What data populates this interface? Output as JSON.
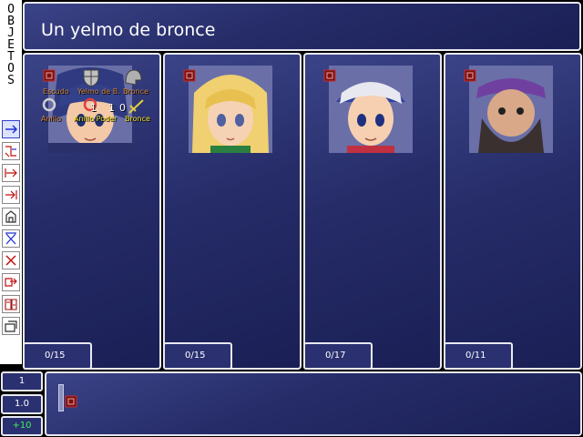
{
  "sidebar": {
    "label_letters": [
      "O",
      "B",
      "J",
      "E",
      "T",
      "O",
      "S"
    ],
    "tools": [
      {
        "name": "arrow-right-tool-icon",
        "active": true
      },
      {
        "name": "swap-tool-icon"
      },
      {
        "name": "move-to-tool-icon"
      },
      {
        "name": "move-to-end-tool-icon"
      },
      {
        "name": "equip-tool-icon"
      },
      {
        "name": "unequip-tool-icon"
      },
      {
        "name": "discard-tool-icon"
      },
      {
        "name": "transfer-tool-icon"
      },
      {
        "name": "sort-tool-icon"
      },
      {
        "name": "window-tool-icon"
      }
    ]
  },
  "header": {
    "title": "Un yelmo de bronce"
  },
  "party": [
    {
      "counter": "0/15",
      "portrait": "hero-blue-hair"
    },
    {
      "counter": "0/15",
      "portrait": "blonde-girl"
    },
    {
      "counter": "0/17",
      "portrait": "bandana-boy"
    },
    {
      "counter": "0/11",
      "portrait": "bearded-man"
    }
  ],
  "overlay": {
    "row1": [
      "Escudo",
      "Yelmo de B.",
      "Bronce"
    ],
    "row2": [
      "Anillo",
      "Anillo Poder",
      "Bronce"
    ],
    "numbers": [
      "1",
      "1",
      "0"
    ]
  },
  "bottom": {
    "quantity": "1",
    "multiplier": "1.0",
    "increment": "+10"
  },
  "colors": {
    "panel": "#262c68",
    "border": "#e8e8f0",
    "increment": "#3cf05a",
    "highlight_text": "#f0e020"
  }
}
